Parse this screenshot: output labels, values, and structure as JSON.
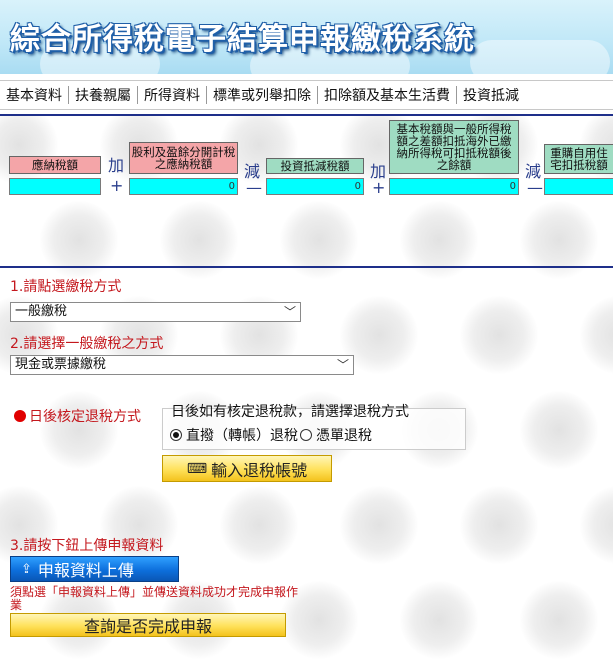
{
  "header": {
    "title": "綜合所得稅電子結算申報繳稅系統"
  },
  "nav": {
    "tabs": [
      "基本資料",
      "扶養親屬",
      "所得資料",
      "標準或列舉扣除",
      "扣除額及基本生活費",
      "投資抵減"
    ]
  },
  "formula": {
    "items": [
      {
        "label": "應納稅額",
        "value": ""
      },
      {
        "label": "股利及盈餘分開計稅之應納稅額",
        "value": "0"
      },
      {
        "label": "投資抵減稅額",
        "value": "0"
      },
      {
        "label": "基本稅額與一般所得稅額之差額扣抵海外已繳納所得稅可扣抵稅額後之餘額",
        "value": "0"
      },
      {
        "label": "重購自用住宅扣抵稅額",
        "value": ""
      }
    ],
    "operators": [
      {
        "word": "加",
        "symbol": "+"
      },
      {
        "word": "減",
        "symbol": "—"
      },
      {
        "word": "加",
        "symbol": "+"
      },
      {
        "word": "減",
        "symbol": "—"
      }
    ]
  },
  "payment": {
    "step1_label": "1.請點選繳稅方式",
    "method_selected": "一般繳稅",
    "step2_label": "2.請選擇一般繳稅之方式",
    "submethod_selected": "現金或票據繳稅"
  },
  "refund": {
    "label": "日後核定退稅方式",
    "question": "日後如有核定退稅款，請選擇退稅方式",
    "option_direct": "直撥（轉帳）退稅",
    "option_check": "憑單退稅",
    "selected": "direct",
    "account_button": "輸入退稅帳號"
  },
  "upload": {
    "step3_label": "3.請按下鈕上傳申報資料",
    "upload_button": "申報資料上傳",
    "note": "須點選「申報資料上傳」並傳送資料成功才完成申報作業",
    "check_button": "查詢是否完成申報"
  },
  "colors": {
    "label_pink": "#f4a5a8",
    "label_green": "#9fdcc2",
    "value_cyan": "#00ffff",
    "step_red": "#c4181e",
    "divider_navy": "#1e2f8a"
  }
}
